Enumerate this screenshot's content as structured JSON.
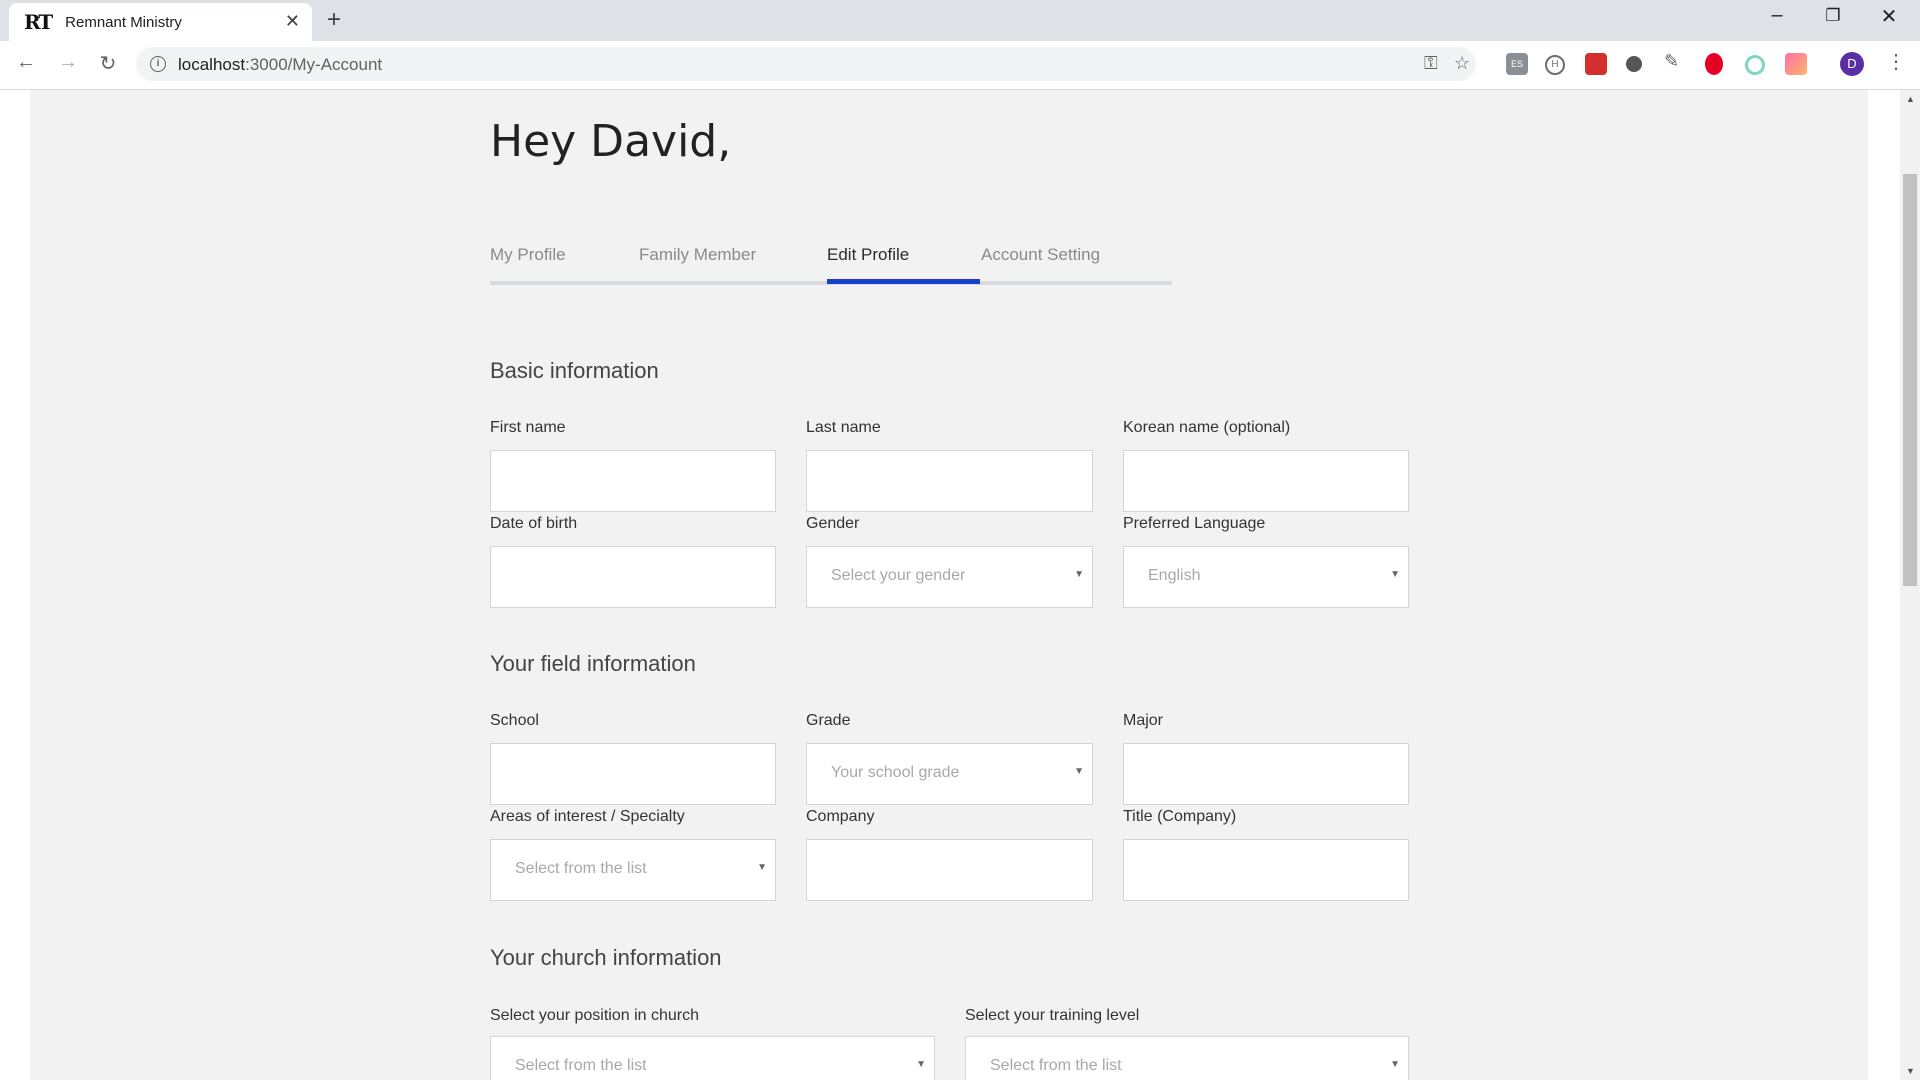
{
  "browser": {
    "tab_title": "Remnant Ministry",
    "favicon_text": "RT",
    "url_host": "localhost",
    "url_path": ":3000/My-Account",
    "avatar_letter": "D",
    "extension_es_label": "ES",
    "extension_h_label": "H"
  },
  "page": {
    "greeting": "Hey David,",
    "tabs": [
      {
        "label": "My Profile"
      },
      {
        "label": "Family Member"
      },
      {
        "label": "Edit Profile"
      },
      {
        "label": "Account Setting"
      }
    ],
    "active_tab": "Edit Profile",
    "accent_color": "#1741c8"
  },
  "basic": {
    "title": "Basic information",
    "first_name_label": "First name",
    "first_name_value": "",
    "last_name_label": "Last name",
    "last_name_value": "",
    "korean_name_label": "Korean name (optional)",
    "korean_name_value": "",
    "dob_label": "Date of birth",
    "dob_value": "",
    "gender_label": "Gender",
    "gender_placeholder": "Select your gender",
    "language_label": "Preferred Language",
    "language_value": "English"
  },
  "field_info": {
    "title": "Your field information",
    "school_label": "School",
    "school_value": "",
    "grade_label": "Grade",
    "grade_placeholder": "Your school grade",
    "major_label": "Major",
    "major_value": "",
    "interest_label": "Areas of interest / Specialty",
    "interest_placeholder": "Select from the list",
    "company_label": "Company",
    "company_value": "",
    "title_company_label": "Title (Company)",
    "title_company_value": ""
  },
  "church": {
    "title": "Your church information",
    "position_label": "Select your position in church",
    "position_placeholder": "Select from the list",
    "training_label": "Select your training level",
    "training_placeholder": "Select from the list"
  }
}
